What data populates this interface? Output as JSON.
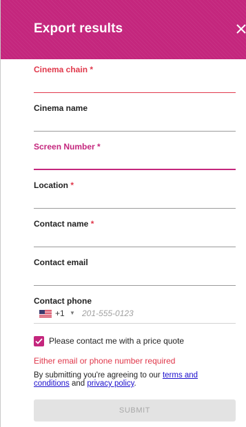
{
  "header": {
    "title": "Export results",
    "close_icon": "close-icon"
  },
  "fields": {
    "cinema_chain": {
      "label": "Cinema chain",
      "required": "*",
      "value": ""
    },
    "cinema_name": {
      "label": "Cinema name",
      "value": ""
    },
    "screen_number": {
      "label": "Screen Number",
      "required": "*",
      "value": ""
    },
    "location": {
      "label": "Location",
      "required": "*",
      "value": ""
    },
    "contact_name": {
      "label": "Contact name",
      "required": "*",
      "value": ""
    },
    "contact_email": {
      "label": "Contact email",
      "value": ""
    },
    "contact_phone": {
      "label": "Contact phone",
      "dial_code": "+1",
      "placeholder": "201-555-0123",
      "value": ""
    }
  },
  "checkbox": {
    "label": "Please contact me with a price quote",
    "checked": true
  },
  "error_message": "Either email or phone number required",
  "terms": {
    "prefix": "By submitting you're agreeing to our ",
    "terms_link": "terms and conditions",
    "middle": " and ",
    "privacy_link": "privacy policy",
    "suffix": "."
  },
  "submit_label": "SUBMIT",
  "colors": {
    "brand": "#c4267d",
    "error": "#e0374a",
    "link": "#1a0dcc",
    "disabled_bg": "#e3e3e3"
  }
}
